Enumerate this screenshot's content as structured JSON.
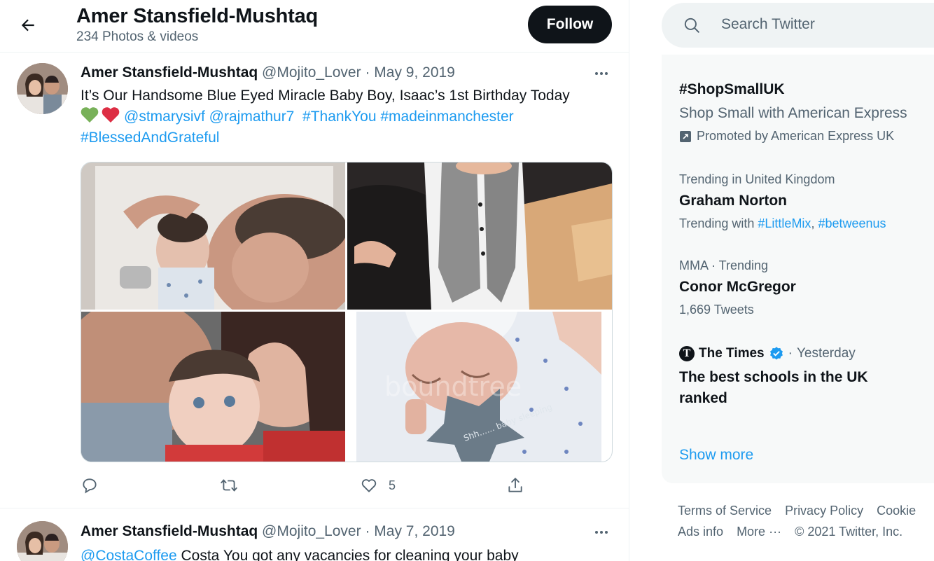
{
  "header": {
    "name": "Amer Stansfield-Mushtaq",
    "subtitle": "234 Photos & videos",
    "follow_label": "Follow"
  },
  "tweet1": {
    "name": "Amer Stansfield-Mushtaq",
    "handle": "@Mojito_Lover",
    "sep": "·",
    "date": "May 9, 2019",
    "line1": "It’s Our Handsome Blue Eyed Miracle Baby Boy, Isaac’s 1st Birthday Today",
    "mention1": "@stmarysivf",
    "mention2": "@rajmathur7",
    "tag1": "#ThankYou",
    "tag2": "#madeinmanchester",
    "tag3": "#BlessedAndGrateful",
    "photo_watermark": "boundtree",
    "star_text": "Shh...... baby sleeping",
    "likes": "5"
  },
  "tweet2": {
    "name": "Amer Stansfield-Mushtaq",
    "handle": "@Mojito_Lover",
    "sep": "·",
    "date": "May 7, 2019",
    "mention": "@CostaCoffee",
    "text": " Costa You got any vacancies for cleaning your baby"
  },
  "search": {
    "placeholder": "Search Twitter"
  },
  "trends": {
    "promo": {
      "tag": "#ShopSmallUK",
      "title": "Shop Small with American Express",
      "promoted": "Promoted by American Express UK"
    },
    "t1": {
      "context": "Trending in United Kingdom",
      "name": "Graham Norton",
      "with_label": "Trending with",
      "w1": "#LittleMix",
      "comma": ",",
      "w2": "#betweenus"
    },
    "t2": {
      "context": "MMA · Trending",
      "name": "Conor McGregor",
      "count": "1,669 Tweets"
    },
    "t3": {
      "source": "The Times",
      "logo_letter": "T",
      "time": "Yesterday",
      "line1": "The best schools in the UK",
      "line2": "ranked"
    },
    "show_more": "Show more"
  },
  "footer": {
    "terms": "Terms of Service",
    "privacy": "Privacy Policy",
    "cookie": "Cookie",
    "ads": "Ads info",
    "more": "More ···",
    "copyright": "© 2021 Twitter, Inc."
  },
  "colors": {
    "accent": "#1d9bf0",
    "text": "#0f1419",
    "muted": "#536471",
    "panel": "#f7f9f9"
  }
}
